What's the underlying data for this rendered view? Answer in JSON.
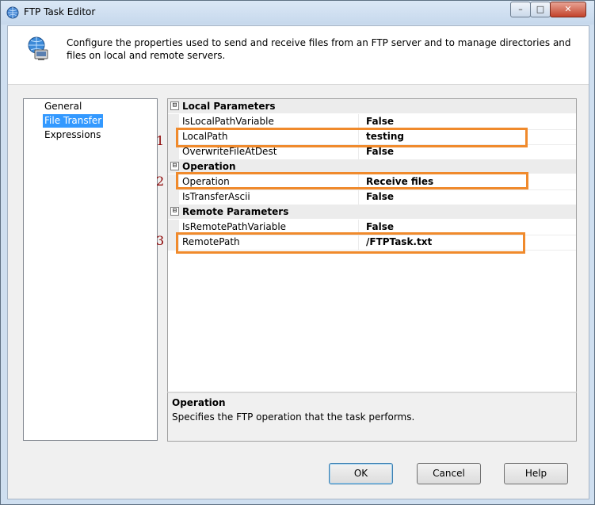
{
  "window": {
    "title": "FTP Task Editor",
    "icon": "ftp-task-icon",
    "controls": {
      "minimize": "–",
      "maximize": "□",
      "close": "✕"
    }
  },
  "header": {
    "icon": "globe-computer-icon",
    "description": "Configure the properties used to send and receive files from an FTP server and to manage directories and files on local and remote servers."
  },
  "nav": {
    "items": [
      {
        "label": "General",
        "selected": false
      },
      {
        "label": "File Transfer",
        "selected": true
      },
      {
        "label": "Expressions",
        "selected": false
      }
    ]
  },
  "grid": {
    "categories": [
      {
        "label": "Local Parameters",
        "toggle": "⊟",
        "properties": [
          {
            "name": "IsLocalPathVariable",
            "value": "False"
          },
          {
            "name": "LocalPath",
            "value": "testing"
          },
          {
            "name": "OverwriteFileAtDest",
            "value": "False"
          }
        ]
      },
      {
        "label": "Operation",
        "toggle": "⊟",
        "properties": [
          {
            "name": "Operation",
            "value": "Receive files"
          },
          {
            "name": "IsTransferAscii",
            "value": "False"
          }
        ]
      },
      {
        "label": "Remote Parameters",
        "toggle": "⊟",
        "properties": [
          {
            "name": "IsRemotePathVariable",
            "value": "False"
          },
          {
            "name": "RemotePath",
            "value": "/FTPTask.txt"
          }
        ]
      }
    ]
  },
  "description": {
    "title": "Operation",
    "text": "Specifies the FTP operation that the task performs."
  },
  "annotations": {
    "labels": [
      "1",
      "2",
      "3"
    ],
    "color": "#f08a2c"
  },
  "buttons": {
    "ok": "OK",
    "cancel": "Cancel",
    "help": "Help"
  },
  "colors": {
    "selection": "#3399ff",
    "highlight_box": "#f08a2c",
    "annotation_number": "#8b0000"
  }
}
